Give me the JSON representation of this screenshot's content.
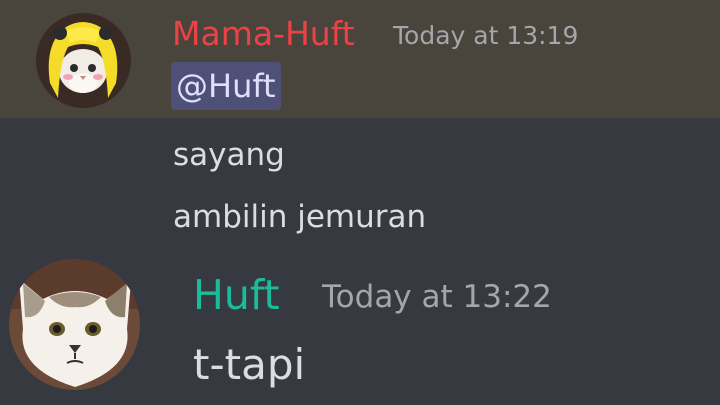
{
  "messages": [
    {
      "author": "Mama-Huft",
      "author_color": "#ed4245",
      "timestamp": "Today at 13:19",
      "mention": "@Huft",
      "lines": [
        "sayang",
        "ambilin jemuran"
      ],
      "highlighted": true,
      "avatar": "yellow-haired-cat-avatar"
    },
    {
      "author": "Huft",
      "author_color": "#1abc9c",
      "timestamp": "Today at 13:22",
      "lines": [
        "t-tapi"
      ],
      "avatar": "cat-avatar"
    }
  ],
  "colors": {
    "background": "#36393f",
    "mention_highlight": "#49443c",
    "mention_pill": "#4e5078"
  }
}
